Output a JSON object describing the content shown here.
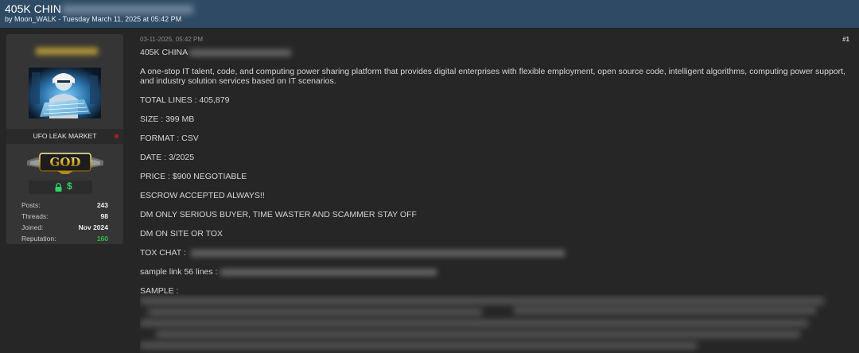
{
  "thread": {
    "title": "405K CHIN",
    "byline_prefix": "by ",
    "author": "Moon_WALK",
    "byline_suffix": " - Tuesday March 11, 2025 at 05:42 PM"
  },
  "user_panel": {
    "avatar_icon": "avatar-hacker-icon",
    "rank_name": "UFO LEAK MARKET",
    "rank_badge_text": "GOD",
    "icons": [
      "lock-icon",
      "dollar-icon"
    ],
    "stats": [
      {
        "label": "Posts:",
        "value": "243"
      },
      {
        "label": "Threads:",
        "value": "98"
      },
      {
        "label": "Joined:",
        "value": "Nov 2024"
      },
      {
        "label": "Reputation:",
        "value": "160"
      }
    ]
  },
  "post": {
    "date": "03-11-2025, 05:42 PM",
    "number": "#1",
    "title_line": "405K CHINA",
    "description": "A one-stop IT talent, code, and computing power sharing platform that provides digital enterprises with flexible employment, open source code, intelligent algorithms, computing power support, and industry solution services based on IT scenarios.",
    "lines": [
      "TOTAL LINES : 405,879",
      "SIZE : 399 MB",
      "FORMAT : CSV",
      "DATE : 3/2025",
      "PRICE : $900  NEGOTIABLE",
      "ESCROW ACCEPTED ALWAYS!!",
      "DM ONLY SERIOUS BUYER, TIME WASTER AND SCAMMER STAY OFF",
      "DM ON SITE OR TOX"
    ],
    "tox_label": "TOX CHAT :",
    "sample_link_label": "sample link 56 lines :",
    "sample_label": "SAMPLE :"
  },
  "colors": {
    "header_bg": "#2f4a64",
    "page_bg": "#262626",
    "panel_bg": "#353535",
    "reputation_green": "#2fbf4a",
    "money_green": "#2fd36a",
    "status_red": "#b21d1d",
    "badge_gold": "#d6a928"
  }
}
